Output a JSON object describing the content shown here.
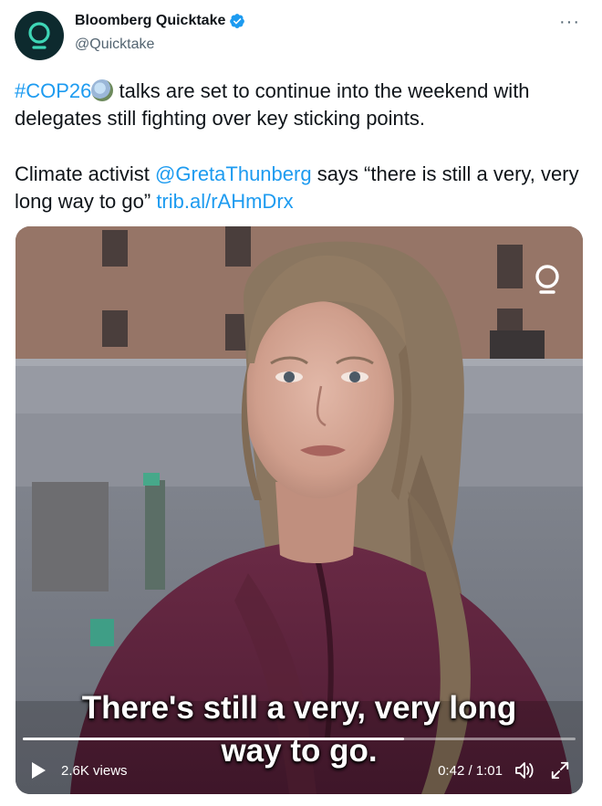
{
  "author": {
    "name": "Bloomberg Quicktake",
    "handle": "@Quicktake",
    "verified": true
  },
  "more_label": "···",
  "tweet": {
    "line1_hashtag": "#COP26",
    "line1_rest": " talks are set to continue into the weekend with delegates still fighting over key sticking points.",
    "line2_prefix": "Climate activist ",
    "line2_mention": "@GretaThunberg",
    "line2_quote": " says “there is still a very, very long way to go” ",
    "line2_link": "trib.al/rAHmDrx"
  },
  "video": {
    "caption_line1": "There's still a very, very long",
    "caption_line2": "way to go.",
    "views": "2.6K views",
    "time": "0:42 / 1:01",
    "progress_fraction": 0.69
  },
  "colors": {
    "link": "#1d9bf0",
    "verified": "#1d9bf0",
    "avatar_bg": "#0d2a2e",
    "brand_teal": "#3ed6b6"
  }
}
